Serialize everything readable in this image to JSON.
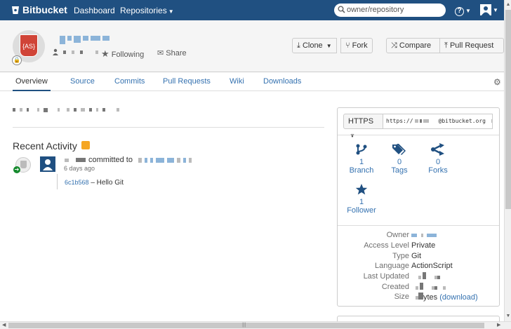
{
  "topbar": {
    "brand": "Bitbucket",
    "dashboard": "Dashboard",
    "repositories": "Repositories",
    "search_placeholder": "owner/repository",
    "help": "?"
  },
  "header": {
    "avatar_text": "{AS}",
    "following": "Following",
    "share": "Share",
    "clone": "Clone",
    "fork": "Fork",
    "compare": "Compare",
    "pull_request": "Pull Request"
  },
  "tabs": [
    "Overview",
    "Source",
    "Commits",
    "Pull Requests",
    "Wiki",
    "Downloads"
  ],
  "activity": {
    "title": "Recent Activity",
    "committed_to": "committed to",
    "date": "6 days ago",
    "commit_hash": "6c1b568",
    "commit_message": "– Hello Git"
  },
  "clone_box": {
    "protocol": "HTTPS",
    "url_prefix": "https://",
    "url_suffix": "@bitbucket.org"
  },
  "stats": [
    {
      "count": "1",
      "label": "Branch",
      "icon": "branch-icon"
    },
    {
      "count": "0",
      "label": "Tags",
      "icon": "tag-icon"
    },
    {
      "count": "0",
      "label": "Forks",
      "icon": "fork-icon"
    },
    {
      "count": "1",
      "label": "Follower",
      "icon": "star-icon"
    }
  ],
  "info": {
    "owner_label": "Owner",
    "access_label": "Access Level",
    "access_value": "Private",
    "type_label": "Type",
    "type_value": "Git",
    "language_label": "Language",
    "language_value": "ActionScript",
    "updated_label": "Last Updated",
    "created_label": "Created",
    "size_label": "Size",
    "size_value": "ytes",
    "download_link": "(download)"
  },
  "colors": {
    "brand": "#205081",
    "link": "#3572b0",
    "repo_icon": "#d04437"
  }
}
